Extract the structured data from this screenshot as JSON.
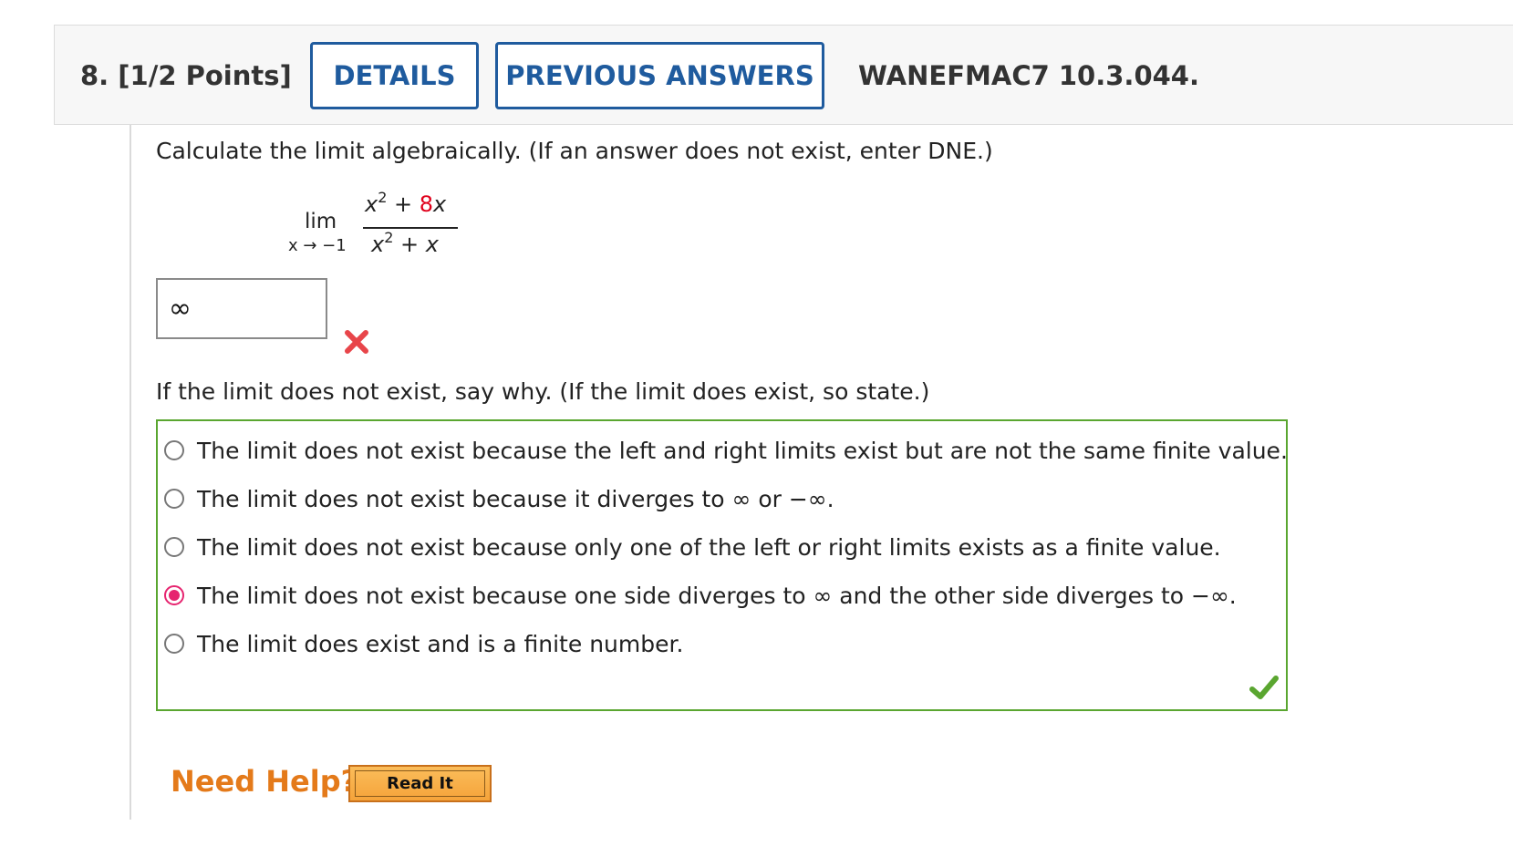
{
  "header": {
    "question_number": "8. [1/2 Points]",
    "details_label": "DETAILS",
    "previous_answers_label": "PREVIOUS ANSWERS",
    "question_id": "WANEFMAC7 10.3.044."
  },
  "problem": {
    "prompt": "Calculate the limit algebraically. (If an answer does not exist, enter DNE.)",
    "limit": {
      "lim_label": "lim",
      "approach": "x → −1",
      "numerator_term1": "x",
      "numerator_exp": "2",
      "numerator_op": " + ",
      "numerator_coef": "8",
      "numerator_var": "x",
      "denominator_term1": "x",
      "denominator_exp": "2",
      "denominator_op": " + ",
      "denominator_var": "x"
    },
    "answer_value": "∞",
    "answer_status": "incorrect"
  },
  "followup": {
    "prompt": "If the limit does not exist, say why. (If the limit does exist, so state.)",
    "options": [
      {
        "label": "The limit does not exist because the left and right limits exist but are not the same finite value.",
        "selected": false
      },
      {
        "label": "The limit does not exist because it diverges to ∞ or −∞.",
        "selected": false
      },
      {
        "label": "The limit does not exist because only one of the left or right limits exists as a finite value.",
        "selected": false
      },
      {
        "label": "The limit does not exist because one side diverges to ∞ and the other side diverges to −∞.",
        "selected": true
      },
      {
        "label": "The limit does exist and is a finite number.",
        "selected": false
      }
    ],
    "status": "correct"
  },
  "help": {
    "need_help_label": "Need Help?",
    "read_it_label": "Read It"
  },
  "colors": {
    "accent_blue": "#1f5b9e",
    "incorrect_red": "#e8454a",
    "correct_green": "#5aa630",
    "selected_pink": "#e6246f",
    "help_orange": "#e47a1a"
  }
}
